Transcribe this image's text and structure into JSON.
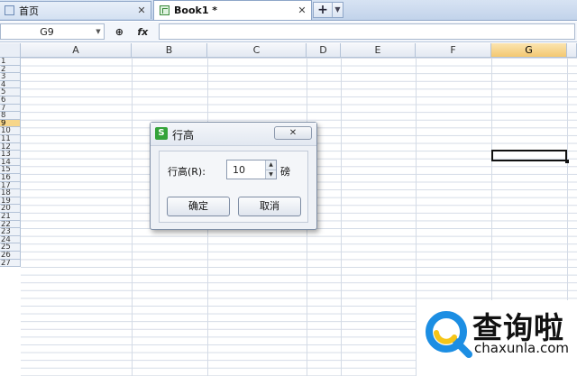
{
  "tabs": [
    {
      "label": "首页",
      "close": "✕"
    },
    {
      "label": "Book1 *",
      "close": "✕"
    }
  ],
  "new_tab": {
    "plus": "+",
    "arrow": "▼"
  },
  "formula_bar": {
    "name_box": "G9",
    "name_arrow": "▼",
    "zoom_icon": "⊕",
    "fx_label": "fx",
    "formula": ""
  },
  "columns": [
    "A",
    "B",
    "C",
    "D",
    "E",
    "F",
    "G"
  ],
  "selected_column": "G",
  "rows": [
    "1",
    "2",
    "3",
    "4",
    "5",
    "6",
    "7",
    "8",
    "9",
    "10",
    "11",
    "12",
    "13",
    "14",
    "15",
    "16",
    "17",
    "18",
    "19",
    "20",
    "21",
    "22",
    "23",
    "24",
    "25",
    "26",
    "27"
  ],
  "selected_row": "9",
  "dialog": {
    "title": "行高",
    "logo_letter": "S",
    "close": "✕",
    "field_label": "行高(R):",
    "value": "10",
    "unit": "磅",
    "ok": "确定",
    "cancel": "取消"
  },
  "watermark": {
    "cn": "查询啦",
    "en": "chaxunla.com"
  },
  "colors": {
    "accent_green": "#34a33a",
    "selection": "#f3c871",
    "wm_blue": "#1c8ee3",
    "wm_yellow": "#f5c518"
  }
}
